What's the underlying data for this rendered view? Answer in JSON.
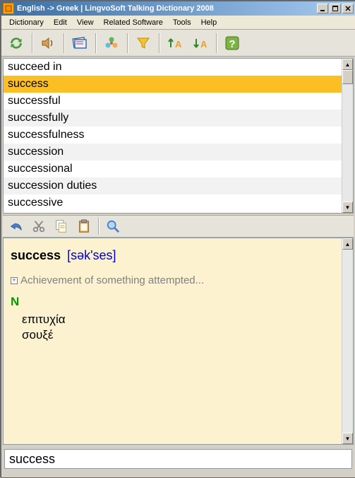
{
  "titlebar": {
    "text": "English -> Greek | LingvoSoft Talking Dictionary 2008"
  },
  "menubar": {
    "items": [
      "Dictionary",
      "Edit",
      "View",
      "Related Software",
      "Tools",
      "Help"
    ]
  },
  "toolbar": {
    "icons": [
      "refresh",
      "speak",
      "copy-card",
      "shapes",
      "filter",
      "sort-up",
      "sort-down",
      "help"
    ]
  },
  "wordlist": {
    "items": [
      {
        "text": "succeed in",
        "sel": false,
        "alt": false
      },
      {
        "text": "success",
        "sel": true,
        "alt": false
      },
      {
        "text": "successful",
        "sel": false,
        "alt": false
      },
      {
        "text": "successfully",
        "sel": false,
        "alt": true
      },
      {
        "text": "successfulness",
        "sel": false,
        "alt": false
      },
      {
        "text": "succession",
        "sel": false,
        "alt": true
      },
      {
        "text": "successional",
        "sel": false,
        "alt": false
      },
      {
        "text": "succession duties",
        "sel": false,
        "alt": true
      },
      {
        "text": "successive",
        "sel": false,
        "alt": false
      }
    ]
  },
  "toolbar2": {
    "icons": [
      "undo",
      "cut",
      "copy",
      "paste",
      "search"
    ]
  },
  "definition": {
    "headword": "success",
    "pronunciation": "[sək'ses]",
    "sense": "Achievement of something attempted...",
    "pos": "N",
    "translations": [
      "επιτυχία",
      "σουξέ"
    ]
  },
  "search": {
    "value": "success"
  }
}
